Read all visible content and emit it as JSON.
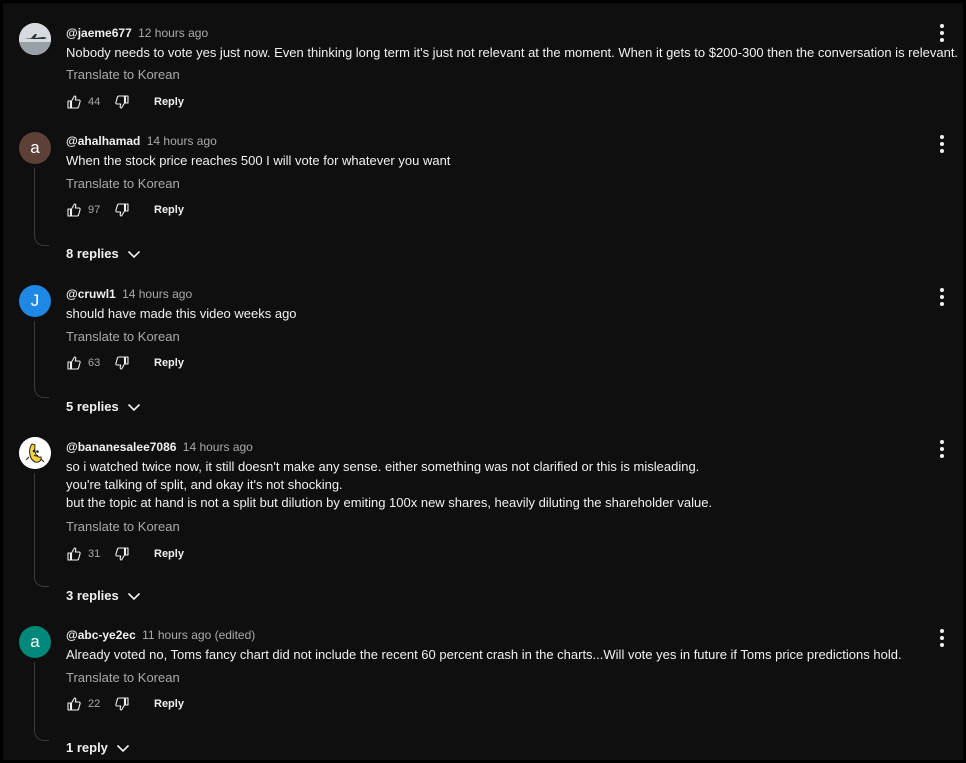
{
  "comments": [
    {
      "author": "@jaeme677",
      "time": "12 hours ago",
      "avatar_letter": "",
      "avatar_color": "#c8ccd2",
      "text_lines": [
        "Nobody needs to vote yes just now. Even thinking long term it's just not relevant at the moment. When it gets to $200-300 then the conversation is relevant."
      ],
      "translate": "Translate to Korean",
      "likes": "44",
      "reply": "Reply",
      "replies": ""
    },
    {
      "author": "@ahalhamad",
      "time": "14 hours ago",
      "avatar_letter": "a",
      "avatar_color": "#5d4037",
      "text_lines": [
        "When the stock price reaches 500  I will vote for whatever you want"
      ],
      "translate": "Translate to Korean",
      "likes": "97",
      "reply": "Reply",
      "replies": "8 replies"
    },
    {
      "author": "@cruwl1",
      "time": "14 hours ago",
      "avatar_letter": "J",
      "avatar_color": "#1e88e5",
      "text_lines": [
        "should have made this video weeks ago"
      ],
      "translate": "Translate to Korean",
      "likes": "63",
      "reply": "Reply",
      "replies": "5 replies"
    },
    {
      "author": "@bananesalee7086",
      "time": "14 hours ago",
      "avatar_letter": "",
      "avatar_color": "#ffffff",
      "text_lines": [
        "so i watched twice now, it still doesn't make any sense. either something was not clarified or this is misleading.",
        "you're talking of split, and okay it's not shocking.",
        "but the topic at hand is not a split but dilution by emiting 100x new shares, heavily diluting the shareholder value."
      ],
      "translate": "Translate to Korean",
      "likes": "31",
      "reply": "Reply",
      "replies": "3 replies"
    },
    {
      "author": "@abc-ye2ec",
      "time": "11 hours ago (edited)",
      "avatar_letter": "a",
      "avatar_color": "#00897b",
      "text_lines": [
        "Already voted no, Toms fancy chart did not include the recent 60 percent crash in the charts...Will vote yes in future if Toms price predictions hold."
      ],
      "translate": "Translate to Korean",
      "likes": "22",
      "reply": "Reply",
      "replies": "1 reply"
    }
  ]
}
